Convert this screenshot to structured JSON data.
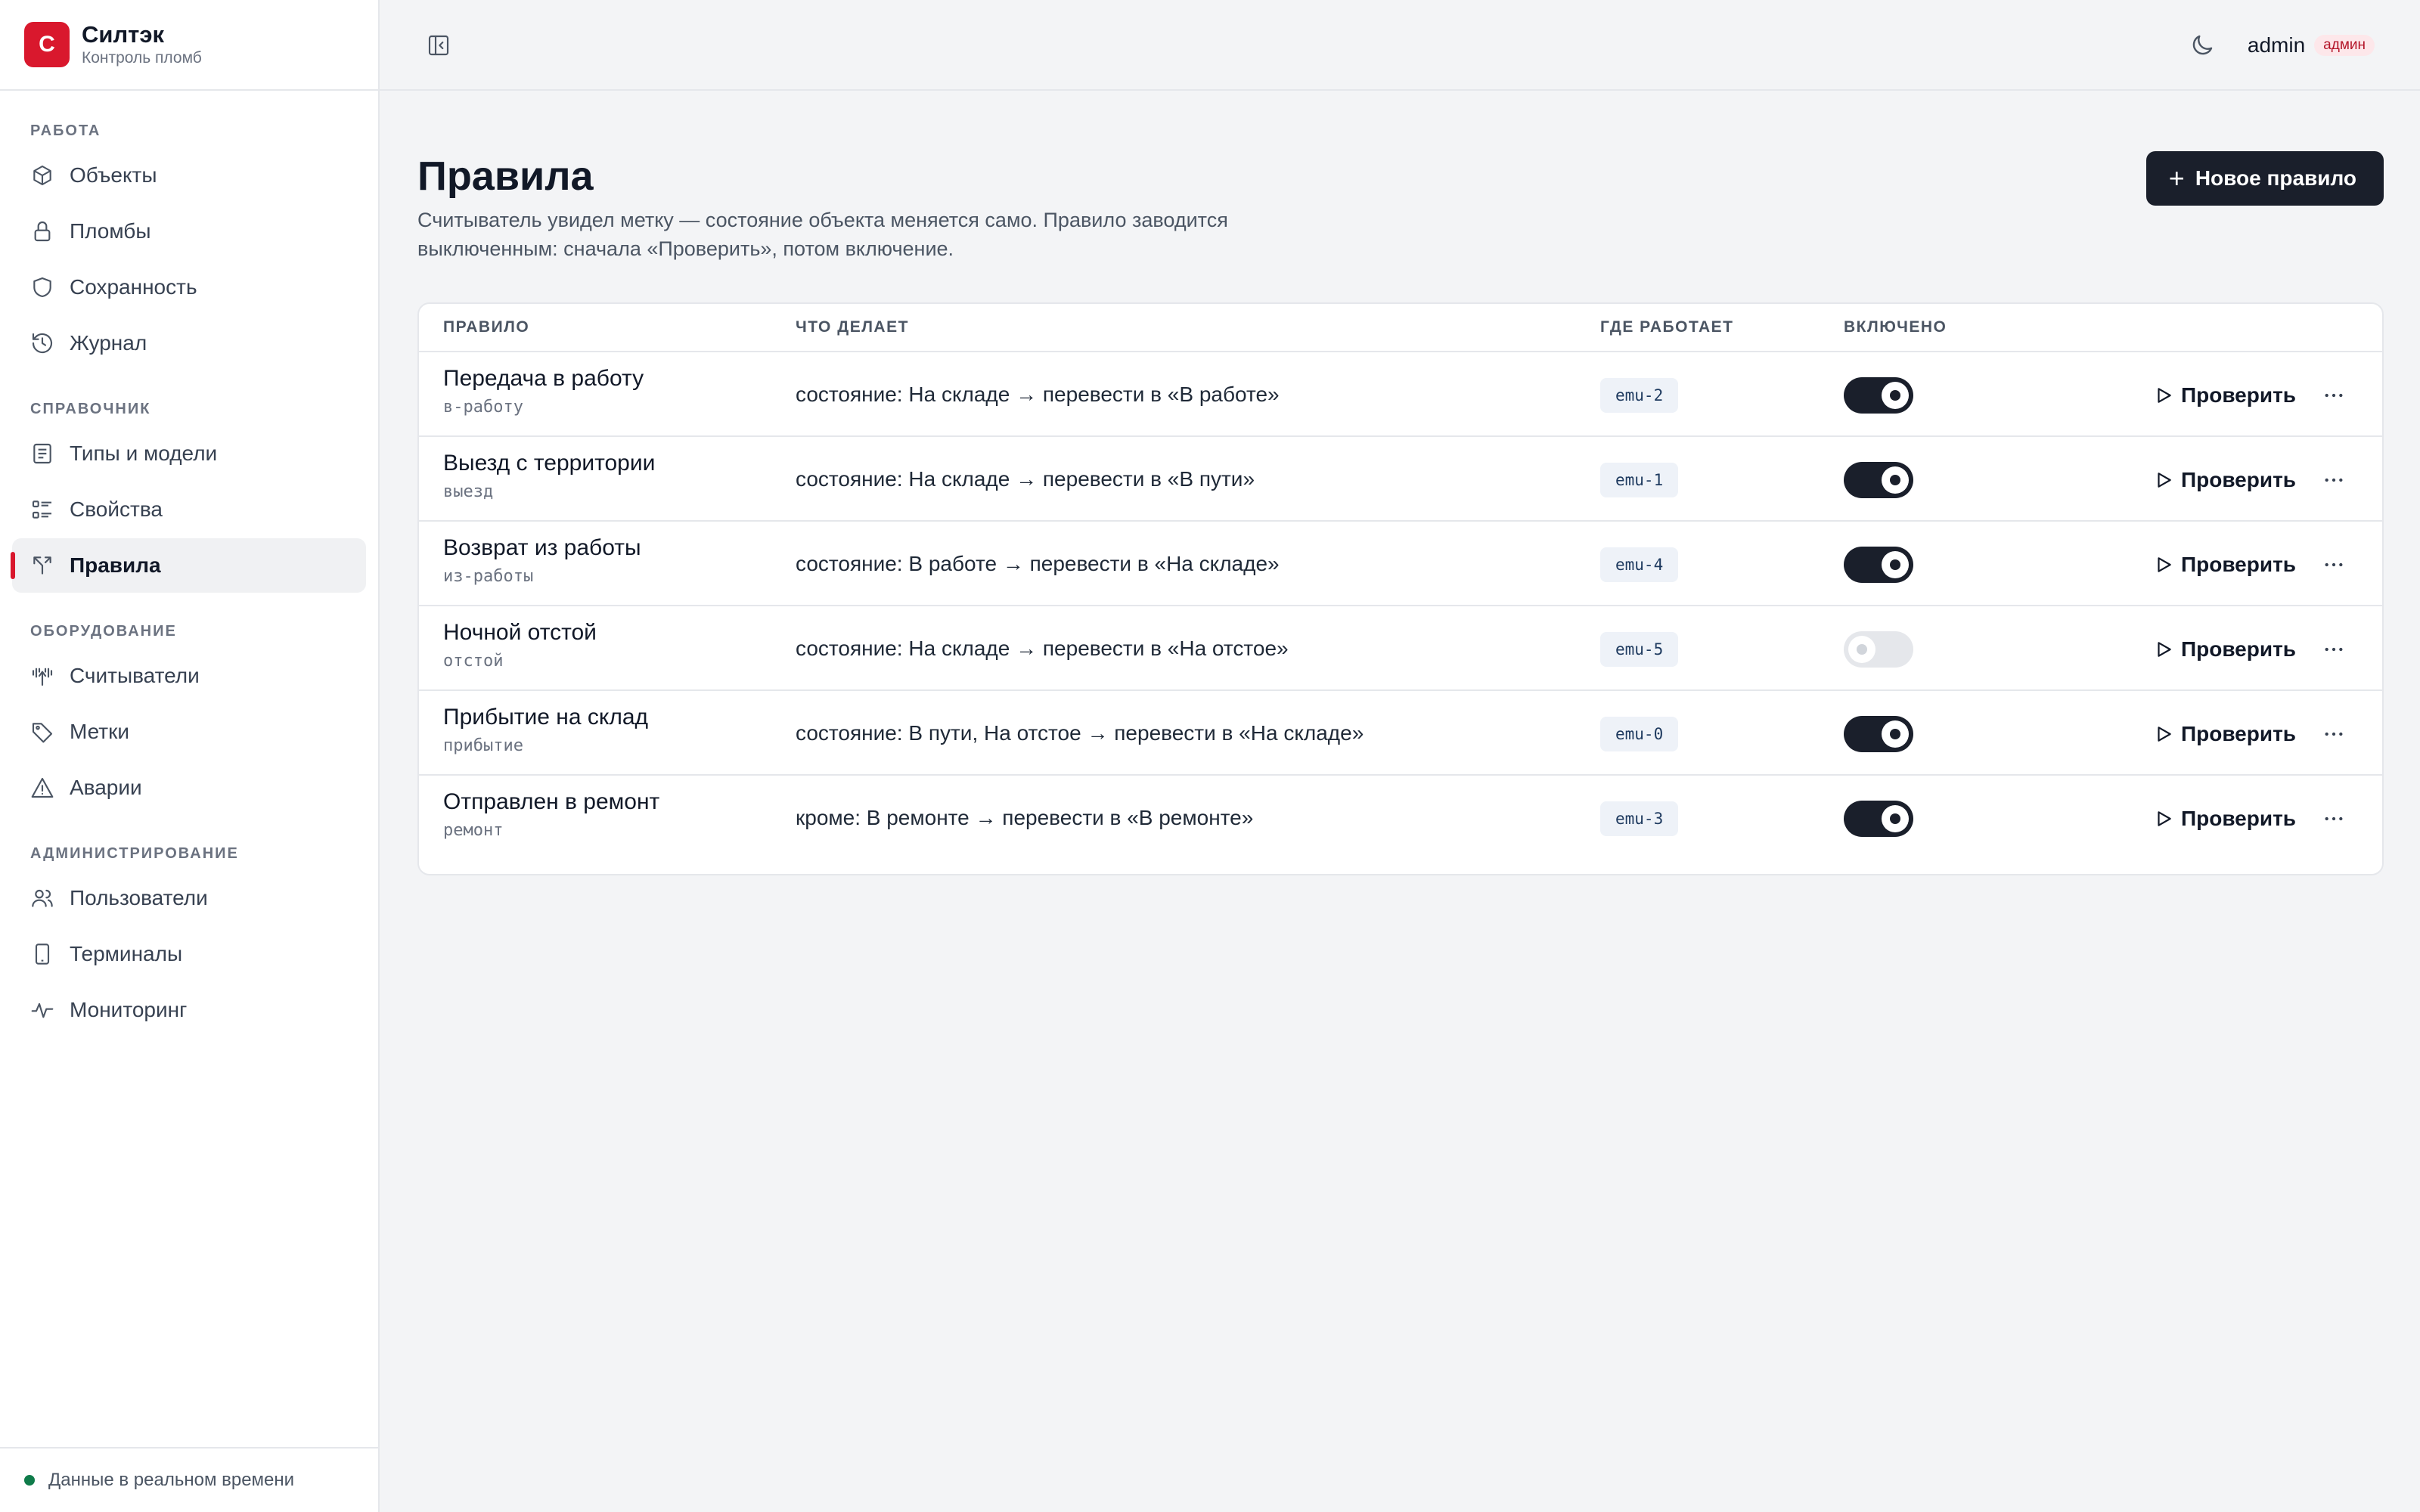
{
  "brand": {
    "logo_letter": "С",
    "name": "Силтэк",
    "subtitle": "Контроль пломб",
    "accent": "#d9182d"
  },
  "sidebar": {
    "sections": [
      {
        "heading": "РАБОТА",
        "items": [
          {
            "label": "Объекты",
            "icon": "cube-icon"
          },
          {
            "label": "Пломбы",
            "icon": "lock-icon"
          },
          {
            "label": "Сохранность",
            "icon": "shield-icon"
          },
          {
            "label": "Журнал",
            "icon": "history-icon"
          }
        ]
      },
      {
        "heading": "СПРАВОЧНИК",
        "items": [
          {
            "label": "Типы и модели",
            "icon": "list-icon"
          },
          {
            "label": "Свойства",
            "icon": "properties-icon"
          },
          {
            "label": "Правила",
            "icon": "split-icon",
            "active": true
          }
        ]
      },
      {
        "heading": "ОБОРУДОВАНИЕ",
        "items": [
          {
            "label": "Считыватели",
            "icon": "antenna-icon"
          },
          {
            "label": "Метки",
            "icon": "tag-icon"
          },
          {
            "label": "Аварии",
            "icon": "warning-icon"
          }
        ]
      },
      {
        "heading": "АДМИНИСТРИРОВАНИЕ",
        "items": [
          {
            "label": "Пользователи",
            "icon": "users-icon"
          },
          {
            "label": "Терминалы",
            "icon": "phone-icon"
          },
          {
            "label": "Мониторинг",
            "icon": "activity-icon"
          }
        ]
      }
    ],
    "footer": {
      "status_text": "Данные в реальном времени",
      "status_color": "#0f7b4a"
    }
  },
  "topbar": {
    "user_name": "admin",
    "role": "админ"
  },
  "page": {
    "title": "Правила",
    "description": "Считыватель увидел метку — состояние объекта меняется само. Правило заводится выключенным: сначала «Проверить», потом включение.",
    "new_button": "Новое правило",
    "new_button_icon": "plus-icon"
  },
  "table": {
    "columns": {
      "name": "ПРАВИЛО",
      "does": "ЧТО ДЕЛАЕТ",
      "where": "ГДЕ РАБОТАЕТ",
      "enabled": "ВКЛЮЧЕНО"
    },
    "check_label": "Проверить",
    "rows": [
      {
        "title": "Передача в работу",
        "slug": "в-работу",
        "does": "состояние: На складе → перевести в «В работе»",
        "reader": "emu-2",
        "enabled": true
      },
      {
        "title": "Выезд с территории",
        "slug": "выезд",
        "does": "состояние: На складе → перевести в «В пути»",
        "reader": "emu-1",
        "enabled": true
      },
      {
        "title": "Возврат из работы",
        "slug": "из-работы",
        "does": "состояние: В работе → перевести в «На складе»",
        "reader": "emu-4",
        "enabled": true
      },
      {
        "title": "Ночной отстой",
        "slug": "отстой",
        "does": "состояние: На складе → перевести в «На отстое»",
        "reader": "emu-5",
        "enabled": false
      },
      {
        "title": "Прибытие на склад",
        "slug": "прибытие",
        "does": "состояние: В пути, На отстое → перевести в «На складе»",
        "reader": "emu-0",
        "enabled": true
      },
      {
        "title": "Отправлен в ремонт",
        "slug": "ремонт",
        "does": "кроме: В ремонте → перевести в «В ремонте»",
        "reader": "emu-3",
        "enabled": true
      }
    ]
  }
}
